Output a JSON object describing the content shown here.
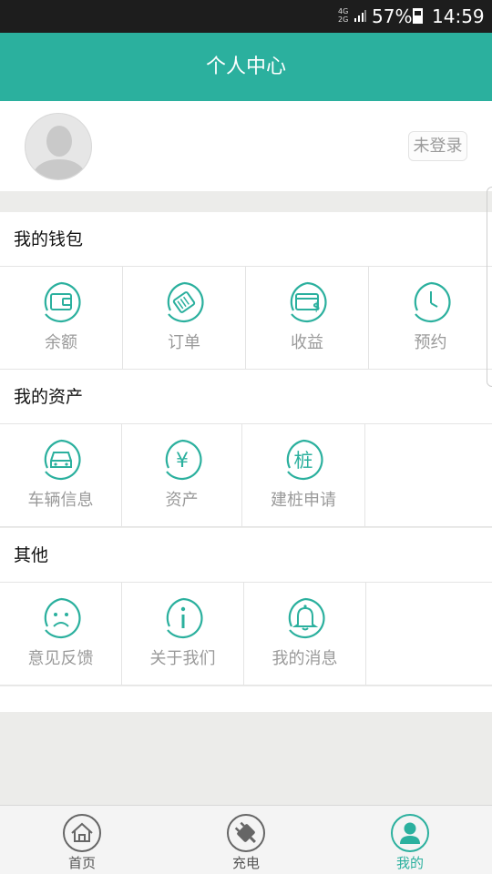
{
  "status_bar": {
    "network": "4G\n2G",
    "battery_pct": "57%",
    "time": "14:59"
  },
  "header": {
    "title": "个人中心"
  },
  "profile": {
    "login_label": "未登录"
  },
  "sections": [
    {
      "title": "我的钱包",
      "items": [
        "余额",
        "订单",
        "收益",
        "预约"
      ]
    },
    {
      "title": "我的资产",
      "items": [
        "车辆信息",
        "资产",
        "建桩申请"
      ]
    },
    {
      "title": "其他",
      "items": [
        "意见反馈",
        "关于我们",
        "我的消息"
      ]
    }
  ],
  "tabs": [
    {
      "label": "首页"
    },
    {
      "label": "充电"
    },
    {
      "label": "我的"
    }
  ],
  "colors": {
    "accent": "#2bb09e",
    "label_gray": "#9a9a9a",
    "background": "#ececea"
  }
}
